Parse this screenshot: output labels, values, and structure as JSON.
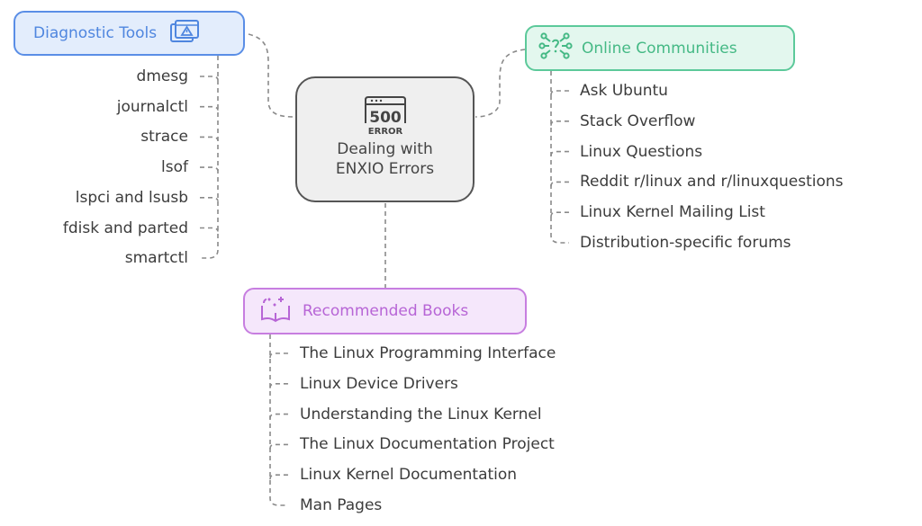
{
  "center": {
    "title_line1": "Dealing with",
    "title_line2": "ENXIO Errors",
    "icon": "500-error-icon",
    "icon_number": "500",
    "icon_label": "ERROR"
  },
  "branches": {
    "diagnostic_tools": {
      "label": "Diagnostic Tools",
      "icon": "window-warning-icon",
      "color": "#4f86df",
      "items": [
        "dmesg",
        "journalctl",
        "strace",
        "lsof",
        "lspci and lsusb",
        "fdisk and parted",
        "smartctl"
      ]
    },
    "online_communities": {
      "label": "Online Communities",
      "icon": "network-nodes-icon",
      "color": "#45b985",
      "items": [
        "Ask Ubuntu",
        "Stack Overflow",
        "Linux Questions",
        "Reddit r/linux and r/linuxquestions",
        "Linux Kernel Mailing List",
        "Distribution-specific forums"
      ]
    },
    "recommended_books": {
      "label": "Recommended Books",
      "icon": "open-book-icon",
      "color": "#b765d6",
      "items": [
        "The Linux Programming Interface",
        "Linux Device Drivers",
        "Understanding the Linux Kernel",
        "The Linux Documentation Project",
        "Linux Kernel Documentation",
        "Man Pages"
      ]
    }
  }
}
